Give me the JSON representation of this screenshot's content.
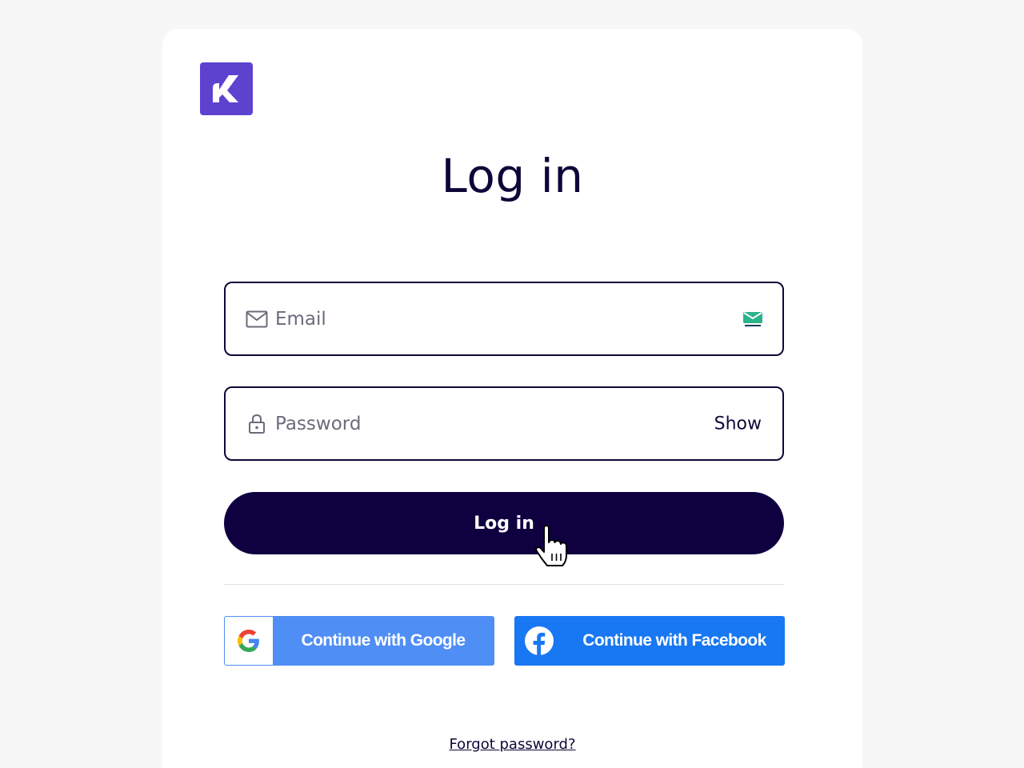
{
  "brand": {
    "logo_letter": "K",
    "logo_color": "#5d42d0",
    "logo_icon": "k-logo-icon"
  },
  "page": {
    "title": "Log in"
  },
  "email_field": {
    "placeholder": "Email",
    "value": "",
    "icon": "mail-icon"
  },
  "password_field": {
    "placeholder": "Password",
    "value": "",
    "icon": "lock-icon",
    "toggle_label": "Show"
  },
  "login_button": {
    "label": "Log in",
    "color": "#0f0040"
  },
  "social": {
    "google_label": "Continue with Google",
    "facebook_label": "Continue with Facebook",
    "google_color": "#4f8ef5",
    "facebook_color": "#1877f2"
  },
  "forgot_password": {
    "label": "Forgot password?"
  }
}
